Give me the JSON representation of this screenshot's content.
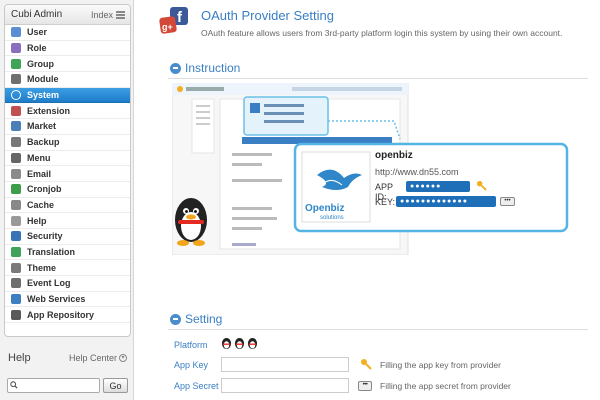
{
  "sidebar": {
    "title": "Cubi Admin",
    "index_label": "Index",
    "items": [
      {
        "label": "User",
        "icon": "user-icon",
        "color": "#5b8fd1"
      },
      {
        "label": "Role",
        "icon": "role-icon",
        "color": "#8a6fbf"
      },
      {
        "label": "Group",
        "icon": "group-icon",
        "color": "#3fa35a"
      },
      {
        "label": "Module",
        "icon": "module-icon",
        "color": "#6f6f6f"
      },
      {
        "label": "System",
        "icon": "system-icon",
        "color": "#ffffff",
        "active": true
      },
      {
        "label": "Extension",
        "icon": "extension-icon",
        "color": "#c05050"
      },
      {
        "label": "Market",
        "icon": "market-icon",
        "color": "#4a7fb8"
      },
      {
        "label": "Backup",
        "icon": "backup-icon",
        "color": "#777777"
      },
      {
        "label": "Menu",
        "icon": "menu-list-icon",
        "color": "#666666"
      },
      {
        "label": "Email",
        "icon": "email-icon",
        "color": "#8a8a8a"
      },
      {
        "label": "Cronjob",
        "icon": "cronjob-icon",
        "color": "#3c9d4a"
      },
      {
        "label": "Cache",
        "icon": "cache-icon",
        "color": "#888888"
      },
      {
        "label": "Help",
        "icon": "help-icon",
        "color": "#999999"
      },
      {
        "label": "Security",
        "icon": "security-icon",
        "color": "#3b73b9"
      },
      {
        "label": "Translation",
        "icon": "translation-icon",
        "color": "#3fa35a"
      },
      {
        "label": "Theme",
        "icon": "theme-icon",
        "color": "#7a7a7a"
      },
      {
        "label": "Event Log",
        "icon": "event-log-icon",
        "color": "#6e6e6e"
      },
      {
        "label": "Web Services",
        "icon": "web-services-icon",
        "color": "#3d7fbf"
      },
      {
        "label": "App Repository",
        "icon": "app-repository-icon",
        "color": "#5a5a5a"
      }
    ]
  },
  "help": {
    "title": "Help",
    "center_label": "Help Center",
    "search_placeholder": "",
    "go_label": "Go"
  },
  "page": {
    "title": "OAuth Provider Setting",
    "description": "OAuth feature allows users from 3rd-party platform login this system by using their own account."
  },
  "instruction": {
    "title": "Instruction",
    "card_name": "openbiz",
    "card_url": "http://www.dn55.com",
    "app_id_label": "APP ID:",
    "key_label": "KEY:",
    "app_id_mask": "●●●●●●",
    "key_mask": "●●●●●●●●●●●●●",
    "logo_word": "Openbiz",
    "logo_sub": "solutions"
  },
  "setting": {
    "title": "Setting",
    "platform_label": "Platform",
    "app_key_label": "App Key",
    "app_key_value": "",
    "app_key_hint": "Filling the app key from provider",
    "app_secret_label": "App Secret",
    "app_secret_value": "",
    "app_secret_hint": "Filling the app secret from provider"
  },
  "colors": {
    "accent": "#3a7fc3",
    "active_nav": "#1e7cc9",
    "card_border": "#55b4e6"
  }
}
